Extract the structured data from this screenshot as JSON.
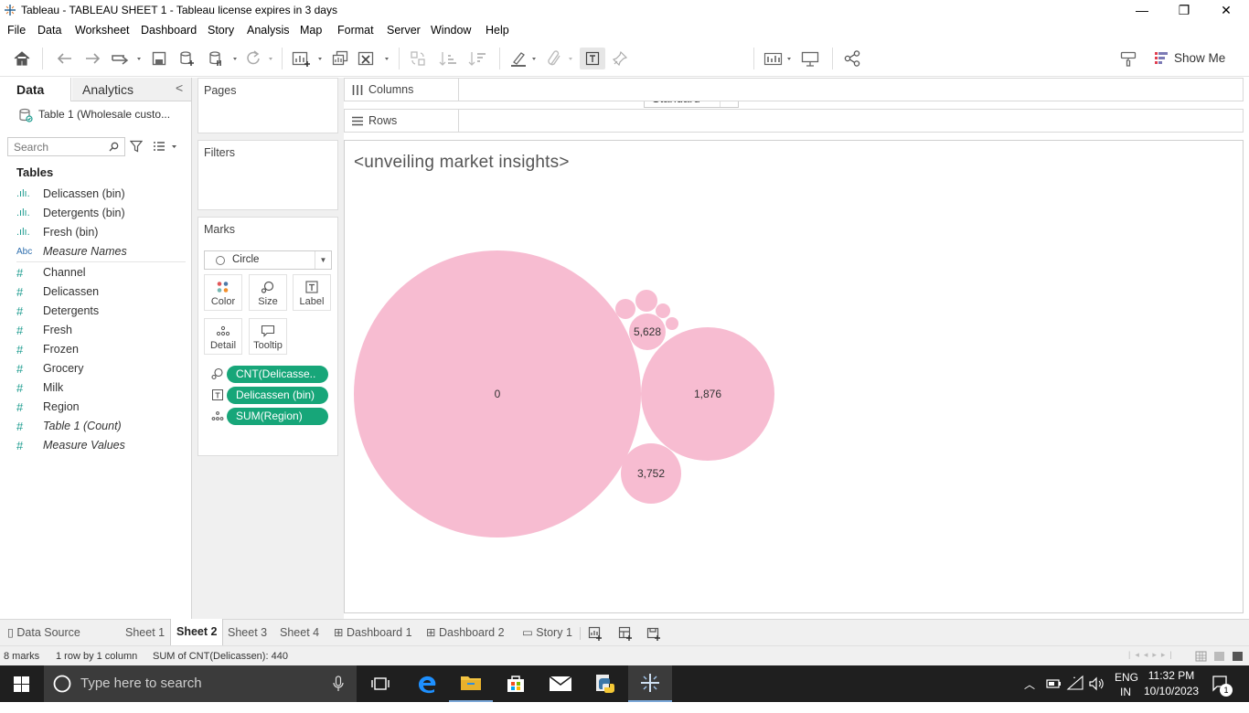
{
  "window": {
    "title": "Tableau - TABLEAU SHEET 1 - Tableau license expires in 3 days",
    "minimize_glyph": "—",
    "maximize_glyph": "❐",
    "close_glyph": "✕"
  },
  "menu": [
    "File",
    "Data",
    "Worksheet",
    "Dashboard",
    "Story",
    "Analysis",
    "Map",
    "Format",
    "Server",
    "Window",
    "Help"
  ],
  "toolbar": {
    "fit_select": "Standard",
    "show_me": "Show Me"
  },
  "left_pane": {
    "tab_data": "Data",
    "tab_analytics": "Analytics",
    "collapse_glyph": "<",
    "data_source": "Table 1 (Wholesale custo...",
    "search_placeholder": "Search",
    "tables_heading": "Tables",
    "dimensions": [
      {
        "icon": ".ılı.",
        "label": "Delicassen (bin)",
        "italic": false
      },
      {
        "icon": ".ılı.",
        "label": "Detergents (bin)",
        "italic": false
      },
      {
        "icon": ".ılı.",
        "label": "Fresh (bin)",
        "italic": false
      },
      {
        "icon": "Abc",
        "label": "Measure Names",
        "italic": true
      }
    ],
    "measures": [
      {
        "icon": "#",
        "label": "Channel",
        "italic": false
      },
      {
        "icon": "#",
        "label": "Delicassen",
        "italic": false
      },
      {
        "icon": "#",
        "label": "Detergents",
        "italic": false
      },
      {
        "icon": "#",
        "label": "Fresh",
        "italic": false
      },
      {
        "icon": "#",
        "label": "Frozen",
        "italic": false
      },
      {
        "icon": "#",
        "label": "Grocery",
        "italic": false
      },
      {
        "icon": "#",
        "label": "Milk",
        "italic": false
      },
      {
        "icon": "#",
        "label": "Region",
        "italic": false
      },
      {
        "icon": "#",
        "label": "Table 1 (Count)",
        "italic": true
      },
      {
        "icon": "#",
        "label": "Measure Values",
        "italic": true
      }
    ]
  },
  "cards": {
    "pages": "Pages",
    "filters": "Filters",
    "marks": "Marks",
    "mark_type": "Circle",
    "mark_buttons": [
      "Color",
      "Size",
      "Label",
      "Detail",
      "Tooltip"
    ],
    "pills": [
      {
        "icon": "size-icon",
        "label": "CNT(Delicasse.."
      },
      {
        "icon": "label-icon",
        "label": "Delicassen (bin)"
      },
      {
        "icon": "detail-icon",
        "label": "SUM(Region)"
      }
    ]
  },
  "shelves": {
    "columns": "Columns",
    "rows": "Rows"
  },
  "viz": {
    "title": "<unveiling market insights>"
  },
  "chart_data": {
    "type": "packed-bubble",
    "title": "<unveiling market insights>",
    "color": "#f7bcd1",
    "bubbles": [
      {
        "label": "0",
        "size_rank": 1
      },
      {
        "label": "1,876",
        "size_rank": 2
      },
      {
        "label": "3,752",
        "size_rank": 3
      },
      {
        "label": "5,628",
        "size_rank": 4
      },
      {
        "label": "",
        "size_rank": 5
      },
      {
        "label": "",
        "size_rank": 6
      },
      {
        "label": "",
        "size_rank": 7
      },
      {
        "label": "",
        "size_rank": 8
      }
    ]
  },
  "sheet_tabs": [
    {
      "label": "Data Source",
      "icon": "▯",
      "active": false
    },
    {
      "label": "Sheet 1",
      "icon": "",
      "active": false
    },
    {
      "label": "Sheet 2",
      "icon": "",
      "active": true
    },
    {
      "label": "Sheet 3",
      "icon": "",
      "active": false
    },
    {
      "label": "Sheet 4",
      "icon": "",
      "active": false
    },
    {
      "label": "Dashboard 1",
      "icon": "⊞",
      "active": false
    },
    {
      "label": "Dashboard 2",
      "icon": "⊞",
      "active": false
    },
    {
      "label": "Story 1",
      "icon": "▭",
      "active": false
    }
  ],
  "status": {
    "marks": "8 marks",
    "rows_cols": "1 row by 1 column",
    "sum": "SUM of CNT(Delicassen): 440"
  },
  "taskbar": {
    "search_placeholder": "Type here to search",
    "lang_1": "ENG",
    "lang_2": "IN",
    "time": "11:32 PM",
    "date": "10/10/2023",
    "notifications": "1"
  }
}
